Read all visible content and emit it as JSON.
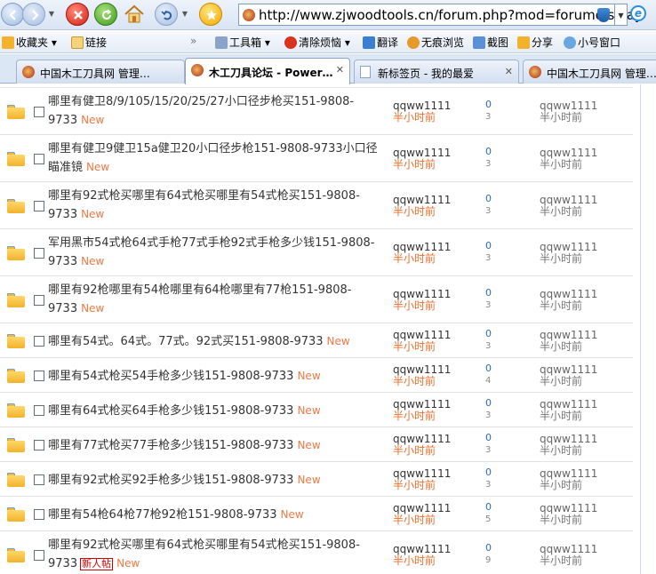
{
  "browser": {
    "url": "http://www.zjwoodtools.cn/forum.php?mod=forumdisplay",
    "toolbar": {
      "favorites": "收藏夹",
      "links": "链接",
      "tools": "工具箱",
      "clear": "清除烦恼",
      "translate": "翻译",
      "privacy": "无痕浏览",
      "screenshot": "截图",
      "share": "分享",
      "mini_window": "小号窗口"
    },
    "tabs": [
      {
        "label": "中国木工刀具网 管理…",
        "active": false
      },
      {
        "label": "木工刀具论坛 - Power…",
        "active": true
      },
      {
        "label": "新标签页 - 我的最爱",
        "active": false
      },
      {
        "label": "中国木工刀具网 管理…",
        "active": false
      }
    ],
    "accent": "#ef7a45",
    "icons": [
      "back-icon",
      "forward-icon",
      "stop-icon",
      "refresh-icon",
      "home-icon",
      "undo-icon",
      "favorite-star-icon",
      "security-shield-icon",
      "ie-icon"
    ]
  },
  "threads": [
    {
      "title": "哪里有健卫8/9/105/15/20/25/27小口径步枪买151-9808-9733",
      "new": "New",
      "newbie": "",
      "author": "qqww1111",
      "post_time": "半小时前",
      "replies": "0",
      "views": "3",
      "last_author": "qqww1111",
      "last_time": "半小时前"
    },
    {
      "title": "哪里有健卫9健卫15a健卫20小口径步枪151-9808-9733小口径瞄准镜",
      "new": "New",
      "newbie": "",
      "author": "qqww1111",
      "post_time": "半小时前",
      "replies": "0",
      "views": "3",
      "last_author": "qqww1111",
      "last_time": "半小时前"
    },
    {
      "title": "哪里有92式枪买哪里有64式枪买哪里有54式枪买151-9808-9733",
      "new": "New",
      "newbie": "",
      "author": "qqww1111",
      "post_time": "半小时前",
      "replies": "0",
      "views": "3",
      "last_author": "qqww1111",
      "last_time": "半小时前"
    },
    {
      "title": "军用黑市54式枪64式手枪77式手枪92式手枪多少钱151-9808-9733",
      "new": "New",
      "newbie": "",
      "author": "qqww1111",
      "post_time": "半小时前",
      "replies": "0",
      "views": "3",
      "last_author": "qqww1111",
      "last_time": "半小时前"
    },
    {
      "title": "哪里有92枪哪里有54枪哪里有64枪哪里有77枪151-9808-9733",
      "new": "New",
      "newbie": "",
      "author": "qqww1111",
      "post_time": "半小时前",
      "replies": "0",
      "views": "3",
      "last_author": "qqww1111",
      "last_time": "半小时前"
    },
    {
      "title": "哪里有54式。64式。77式。92式买151-9808-9733",
      "new": "New",
      "newbie": "",
      "author": "qqww1111",
      "post_time": "半小时前",
      "replies": "0",
      "views": "3",
      "last_author": "qqww1111",
      "last_time": "半小时前"
    },
    {
      "title": "哪里有54式枪买54手枪多少钱151-9808-9733",
      "new": "New",
      "newbie": "",
      "author": "qqww1111",
      "post_time": "半小时前",
      "replies": "0",
      "views": "4",
      "last_author": "qqww1111",
      "last_time": "半小时前"
    },
    {
      "title": "哪里有64式枪买64手枪多少钱151-9808-9733",
      "new": "New",
      "newbie": "",
      "author": "qqww1111",
      "post_time": "半小时前",
      "replies": "0",
      "views": "3",
      "last_author": "qqww1111",
      "last_time": "半小时前"
    },
    {
      "title": "哪里有77式枪买77手枪多少钱151-9808-9733",
      "new": "New",
      "newbie": "",
      "author": "qqww1111",
      "post_time": "半小时前",
      "replies": "0",
      "views": "3",
      "last_author": "qqww1111",
      "last_time": "半小时前"
    },
    {
      "title": "哪里有92式枪买92手枪多少钱151-9808-9733",
      "new": "New",
      "newbie": "",
      "author": "qqww1111",
      "post_time": "半小时前",
      "replies": "0",
      "views": "3",
      "last_author": "qqww1111",
      "last_time": "半小时前"
    },
    {
      "title": "哪里有54枪64枪77枪92枪151-9808-9733",
      "new": "New",
      "newbie": "",
      "author": "qqww1111",
      "post_time": "半小时前",
      "replies": "0",
      "views": "5",
      "last_author": "qqww1111",
      "last_time": "半小时前"
    },
    {
      "title": "哪里有92式枪买哪里有64式枪买哪里有54式枪买151-9808-9733",
      "new": "New",
      "newbie": "新人帖",
      "author": "qqww1111",
      "post_time": "半小时前",
      "replies": "0",
      "views": "9",
      "last_author": "qqww1111",
      "last_time": "半小时前"
    }
  ]
}
